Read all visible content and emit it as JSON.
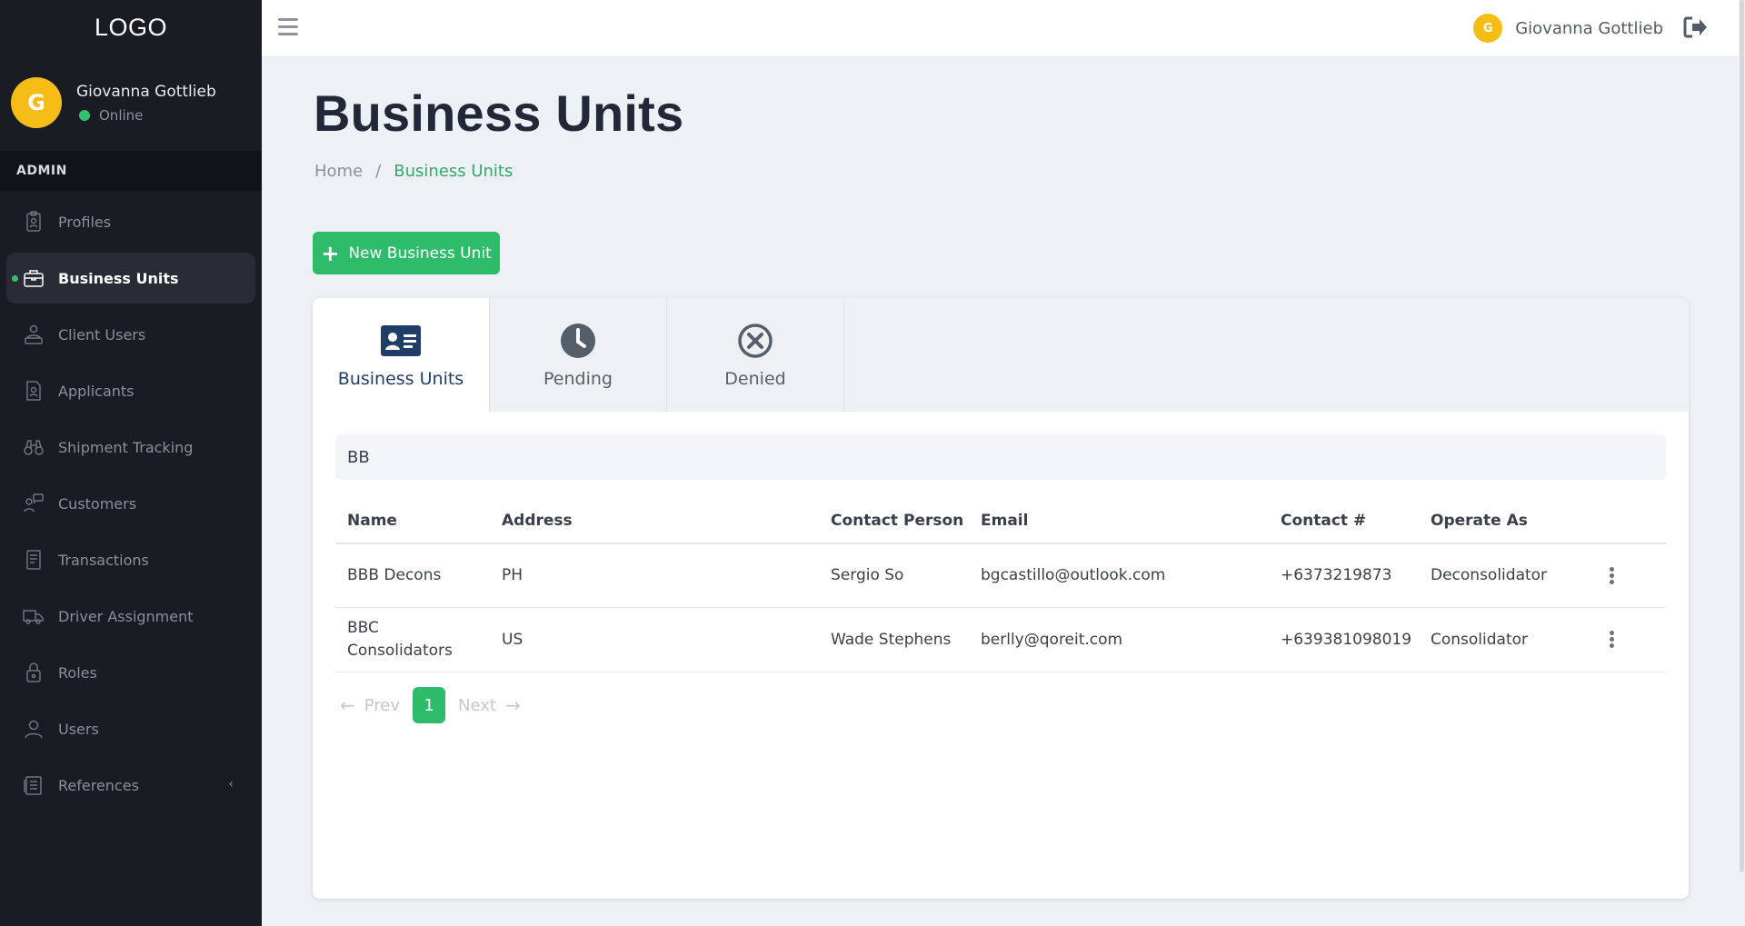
{
  "app": {
    "logo": "LOGO"
  },
  "sidebar": {
    "user": {
      "initial": "G",
      "name": "Giovanna Gottlieb",
      "status": "Online"
    },
    "section": "ADMIN",
    "items": [
      {
        "label": "Profiles",
        "icon": "profile-badge-icon"
      },
      {
        "label": "Business Units",
        "icon": "briefcase-icon",
        "active": true
      },
      {
        "label": "Client Users",
        "icon": "client-user-icon"
      },
      {
        "label": "Applicants",
        "icon": "applicant-icon"
      },
      {
        "label": "Shipment Tracking",
        "icon": "binoculars-icon"
      },
      {
        "label": "Customers",
        "icon": "customer-icon"
      },
      {
        "label": "Transactions",
        "icon": "receipt-icon"
      },
      {
        "label": "Driver Assignment",
        "icon": "truck-icon"
      },
      {
        "label": "Roles",
        "icon": "lock-icon"
      },
      {
        "label": "Users",
        "icon": "user-icon"
      },
      {
        "label": "References",
        "icon": "document-icon",
        "chevron": "‹"
      }
    ]
  },
  "topbar": {
    "user_initial": "G",
    "user_name": "Giovanna Gottlieb"
  },
  "page": {
    "title": "Business Units",
    "breadcrumb": {
      "home": "Home",
      "separator": "/",
      "current": "Business Units"
    },
    "new_button": "New Business Unit"
  },
  "tabs": [
    {
      "label": "Business Units",
      "icon": "id-card-icon",
      "active": true
    },
    {
      "label": "Pending",
      "icon": "clock-icon"
    },
    {
      "label": "Denied",
      "icon": "x-circle-icon"
    }
  ],
  "search": {
    "value": "BB"
  },
  "table": {
    "headers": [
      "Name",
      "Address",
      "Contact Person",
      "Email",
      "Contact #",
      "Operate As"
    ],
    "rows": [
      {
        "name": "BBB Decons",
        "address": "PH",
        "contact_person": "Sergio So",
        "email": "bgcastillo@outlook.com",
        "contact": "+6373219873",
        "operate_as": "Deconsolidator"
      },
      {
        "name": "BBC Consolidators",
        "address": "US",
        "contact_person": "Wade Stephens",
        "email": "berlly@qoreit.com",
        "contact": "+639381098019",
        "operate_as": "Consolidator"
      }
    ]
  },
  "pagination": {
    "prev": "Prev",
    "page": "1",
    "next": "Next"
  },
  "colors": {
    "accent": "#2ebc6a",
    "sidebar_bg": "#1a1c24",
    "avatar": "#f7bd17",
    "tab_active_icon": "#203d67"
  }
}
